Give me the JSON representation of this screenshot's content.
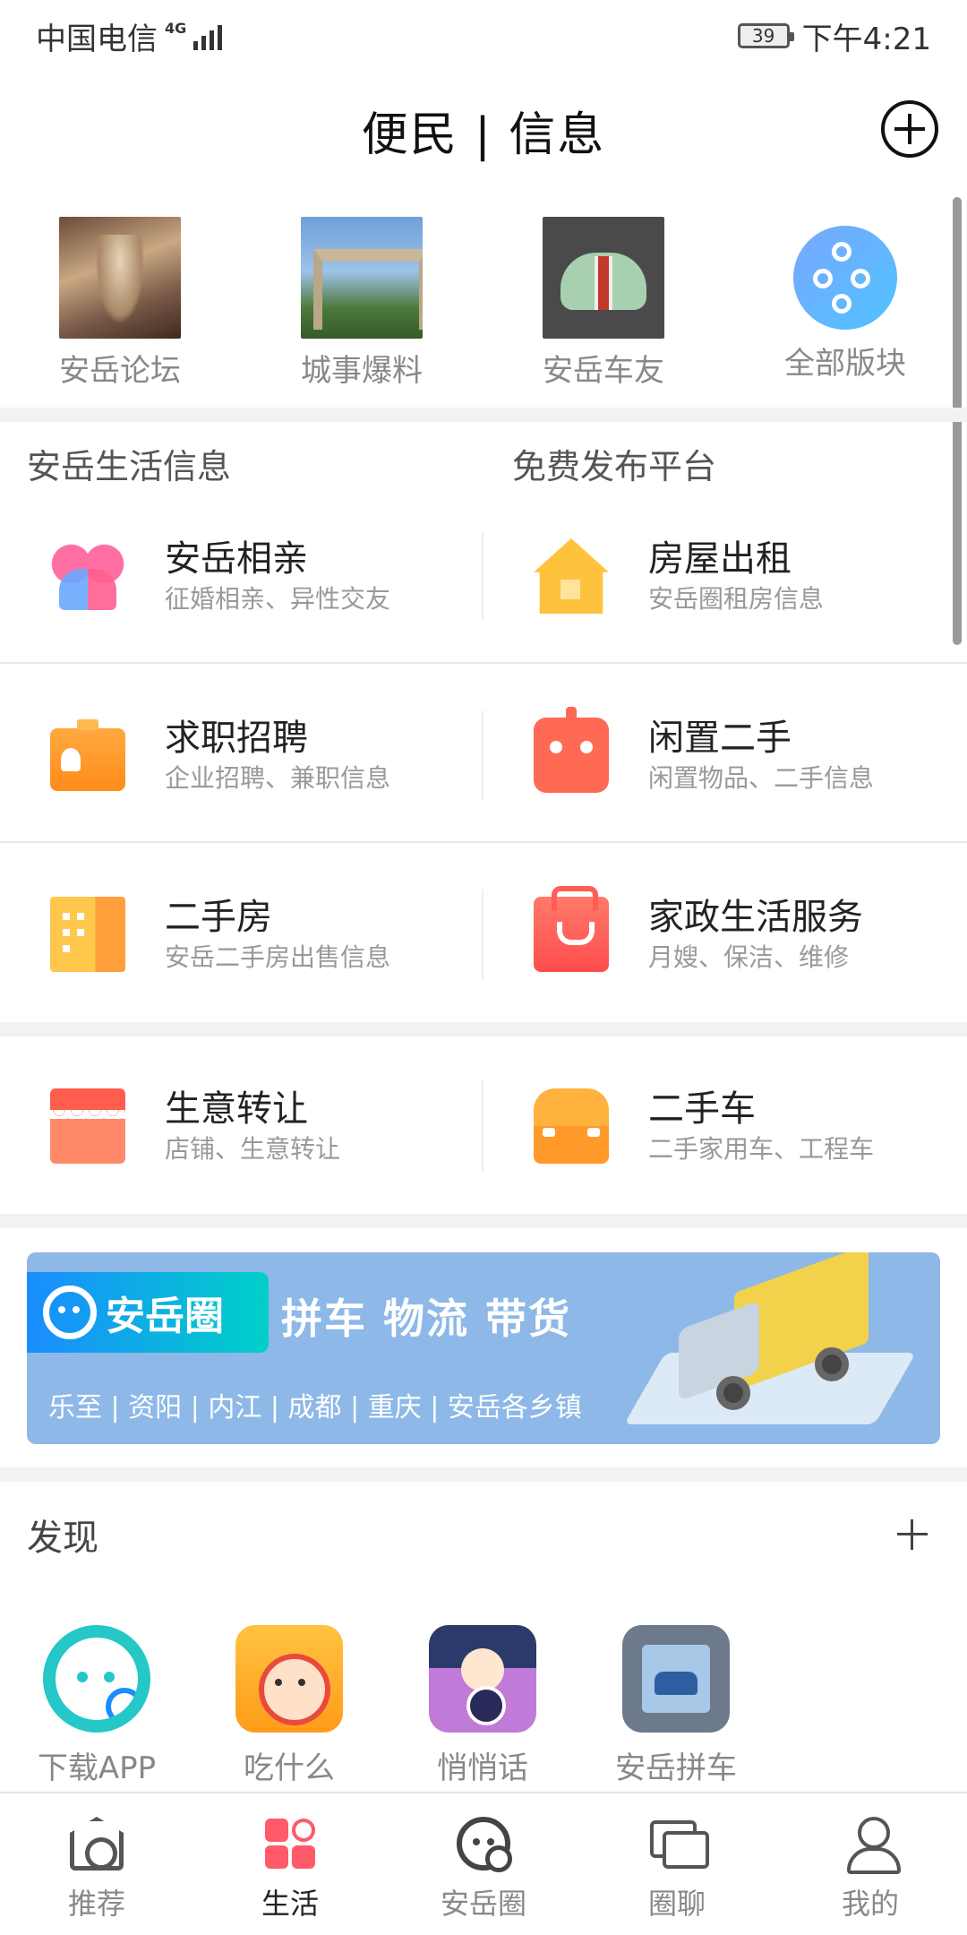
{
  "status_bar": {
    "carrier": "中国电信",
    "network": "4G",
    "battery": "39",
    "time": "下午4:21"
  },
  "header": {
    "title": "便民 | 信息",
    "add_icon": "plus-circle-icon"
  },
  "quick_links": [
    {
      "label": "安岳论坛",
      "icon": "forum-thumbnail"
    },
    {
      "label": "城事爆料",
      "icon": "city-news-thumbnail"
    },
    {
      "label": "安岳车友",
      "icon": "car-club-thumbnail"
    },
    {
      "label": "全部版块",
      "icon": "all-sections-icon"
    }
  ],
  "section": {
    "left_title": "安岳生活信息",
    "right_title": "免费发布平台"
  },
  "services": [
    {
      "title": "安岳相亲",
      "subtitle": "征婚相亲、异性交友",
      "icon": "dating-icon"
    },
    {
      "title": "房屋出租",
      "subtitle": "安岳圈租房信息",
      "icon": "house-icon"
    },
    {
      "title": "求职招聘",
      "subtitle": "企业招聘、兼职信息",
      "icon": "job-card-icon"
    },
    {
      "title": "闲置二手",
      "subtitle": "闲置物品、二手信息",
      "icon": "robot-icon"
    },
    {
      "title": "二手房",
      "subtitle": "安岳二手房出售信息",
      "icon": "building-icon"
    },
    {
      "title": "家政生活服务",
      "subtitle": "月嫂、保洁、维修",
      "icon": "bag-icon"
    },
    {
      "title": "生意转让",
      "subtitle": "店铺、生意转让",
      "icon": "shop-icon"
    },
    {
      "title": "二手车",
      "subtitle": "二手家用车、工程车",
      "icon": "car-icon"
    }
  ],
  "banner": {
    "logo_text": "安岳圈",
    "slogan": "拼车 物流 带货",
    "cities": "乐至 | 资阳 | 内江 | 成都 | 重庆 | 安岳各乡镇"
  },
  "discover": {
    "title": "发现",
    "apps": [
      {
        "label": "下载APP",
        "icon": "download-app-icon"
      },
      {
        "label": "吃什么",
        "icon": "what-to-eat-icon"
      },
      {
        "label": "悄悄话",
        "icon": "whisper-icon"
      },
      {
        "label": "安岳拼车",
        "icon": "carpool-icon"
      }
    ]
  },
  "tabs": [
    {
      "label": "推荐",
      "icon": "home-icon",
      "active": false
    },
    {
      "label": "生活",
      "icon": "life-grid-icon",
      "active": true
    },
    {
      "label": "安岳圈",
      "icon": "circle-logo-icon",
      "active": false
    },
    {
      "label": "圈聊",
      "icon": "chat-icon",
      "active": false
    },
    {
      "label": "我的",
      "icon": "profile-icon",
      "active": false
    }
  ],
  "colors": {
    "active_tab": "#ff5a6a",
    "banner_bg": "#8db8e8",
    "divider": "#f2f2f2"
  }
}
